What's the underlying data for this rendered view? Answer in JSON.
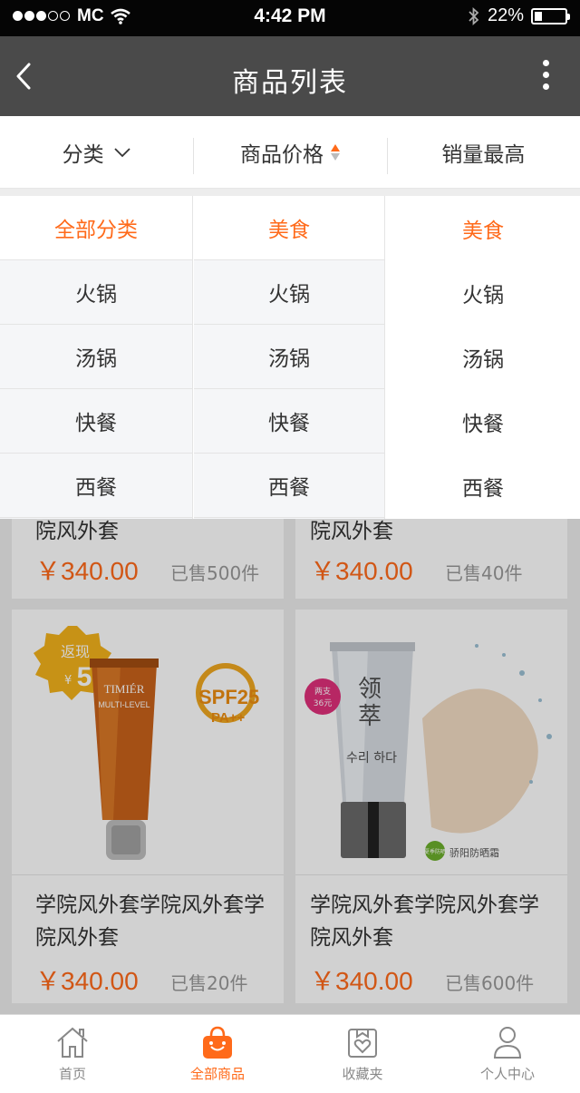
{
  "status_bar": {
    "carrier": "MC",
    "time": "4:42 PM",
    "battery": "22%",
    "battery_level": 0.22
  },
  "nav": {
    "title": "商品列表",
    "back_icon": "chevron-left-icon",
    "more_icon": "more-vertical-icon"
  },
  "filters": {
    "category": "分类",
    "price": "商品价格",
    "sales": "销量最高"
  },
  "dropdown": {
    "col1": [
      "全部分类",
      "火锅",
      "汤锅",
      "快餐",
      "西餐"
    ],
    "col2": [
      "美食",
      "火锅",
      "汤锅",
      "快餐",
      "西餐"
    ],
    "col3": [
      "美食",
      "火锅",
      "汤锅",
      "快餐",
      "西餐"
    ],
    "active_index": 0
  },
  "products": [
    {
      "title": "院风外套",
      "price": "￥340.00",
      "sold": "已售500件"
    },
    {
      "title": "院风外套",
      "price": "￥340.00",
      "sold": "已售40件"
    },
    {
      "title": "学院风外套学院风外套学院风外套",
      "price": "￥340.00",
      "sold": "已售20件",
      "image": {
        "badge_top": "返现",
        "badge_num": "5",
        "badge_currency": "¥",
        "brand": "TIMIÉR",
        "brand_sub": "MULTI-LEVEL",
        "spf": "SPF25",
        "pa": "PA++"
      }
    },
    {
      "title": "学院风外套学院风外套学院风外套",
      "price": "￥340.00",
      "sold": "已售600件",
      "image": {
        "badge_line1": "两支",
        "badge_line2": "36元",
        "brand_cn1": "领",
        "brand_cn2": "萃",
        "korean": "수리 하다",
        "tag": "骄阳防晒霜",
        "tag_badge": "夏季防晒"
      }
    }
  ],
  "tabbar": [
    {
      "label": "首页",
      "icon": "home-icon"
    },
    {
      "label": "全部商品",
      "icon": "shopping-bag-icon"
    },
    {
      "label": "收藏夹",
      "icon": "favorites-icon"
    },
    {
      "label": "个人中心",
      "icon": "user-icon"
    }
  ],
  "colors": {
    "accent": "#ff6a1a",
    "nav_bg": "#4a4a4a",
    "status_bg": "#050505"
  }
}
